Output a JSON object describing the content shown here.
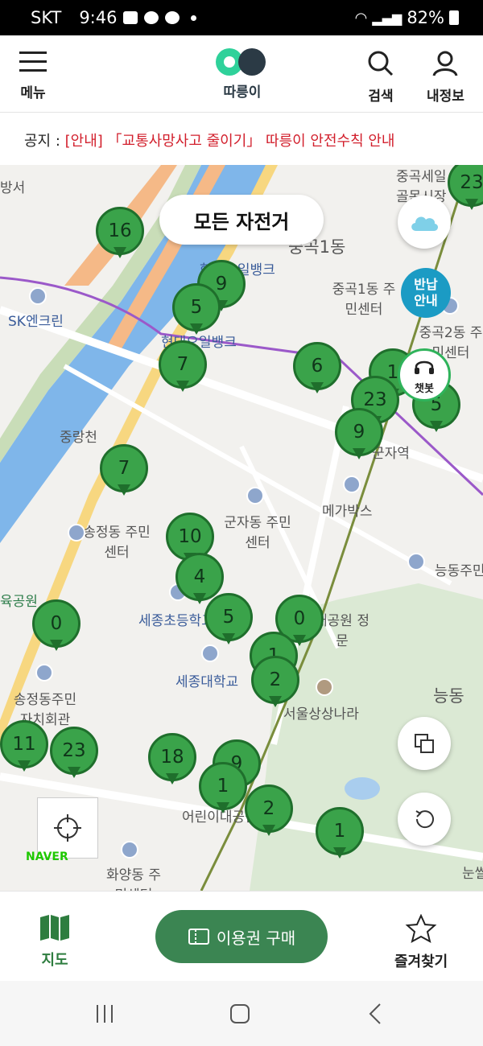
{
  "status": {
    "carrier": "SKT",
    "time": "9:46",
    "battery": "82%"
  },
  "header": {
    "menu_label": "메뉴",
    "logo_text": "따릉이",
    "search_label": "검색",
    "myinfo_label": "내정보"
  },
  "notice": {
    "prefix": "공지 : ",
    "message": "[안내] 「교통사망사고 줄이기」 따릉이 안전수칙 안내"
  },
  "map": {
    "filter_label": "모든 자전거",
    "return_guide_label": "반납\n안내",
    "chatbot_label": "챗봇",
    "naver_label": "NAVER",
    "labels": [
      "방서",
      "중곡1동",
      "SK엔크린",
      "중곡1동 주민센터",
      "중곡2동 주민센터",
      "중곡세일 골목시장",
      "현대오일뱅크",
      "현대오일뱅크",
      "중랑천",
      "군자역",
      "메가박스",
      "군자동 주민센터",
      "송정동 주민센터",
      "능동주민",
      "육공원",
      "세종초등학교",
      "세종대학교",
      "대공원 정문",
      "서울상상나라",
      "능동",
      "송정동주민 자치회관",
      "어린이대공원",
      "화양동 주민센터",
      "눈썰"
    ],
    "stations": [
      {
        "count": "16"
      },
      {
        "count": "9"
      },
      {
        "count": "5"
      },
      {
        "count": "7"
      },
      {
        "count": "6"
      },
      {
        "count": "1"
      },
      {
        "count": "23"
      },
      {
        "count": "5"
      },
      {
        "count": "9"
      },
      {
        "count": "7"
      },
      {
        "count": "10"
      },
      {
        "count": "4"
      },
      {
        "count": "5"
      },
      {
        "count": "0"
      },
      {
        "count": "0"
      },
      {
        "count": "1"
      },
      {
        "count": "2"
      },
      {
        "count": "23"
      },
      {
        "count": "11"
      },
      {
        "count": "18"
      },
      {
        "count": "9"
      },
      {
        "count": "1"
      },
      {
        "count": "2"
      },
      {
        "count": "1"
      },
      {
        "count": "23"
      }
    ]
  },
  "bottom_nav": {
    "map_label": "지도",
    "buy_label": "이용권 구매",
    "favorites_label": "즐겨찾기"
  },
  "colors": {
    "brand_green": "#3b8552",
    "pin_green": "#3aa34a",
    "notice_red": "#d21f2c",
    "return_blue": "#1b9bc4"
  }
}
